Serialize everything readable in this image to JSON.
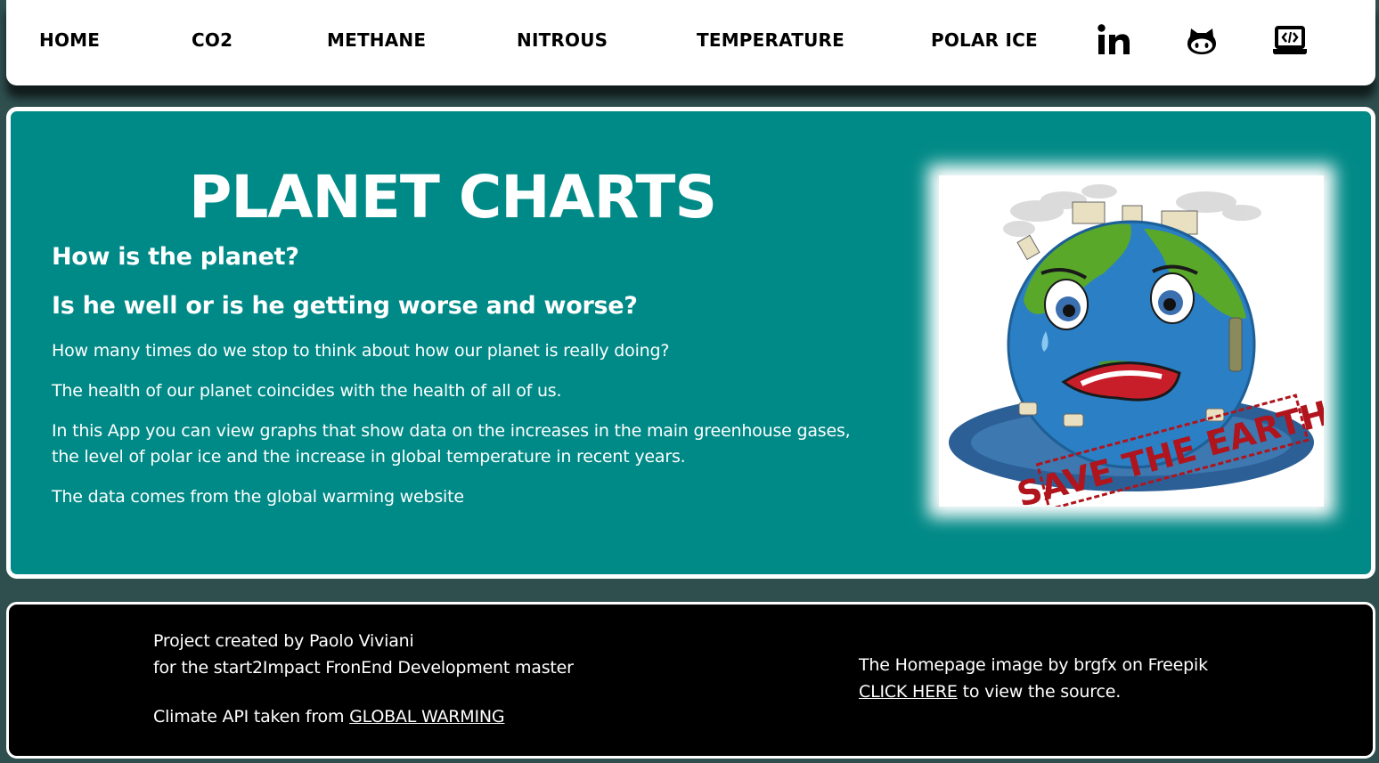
{
  "nav": {
    "items": [
      {
        "label": "HOME"
      },
      {
        "label": "CO2"
      },
      {
        "label": "METHANE"
      },
      {
        "label": "NITROUS"
      },
      {
        "label": "TEMPERATURE"
      },
      {
        "label": "POLAR ICE"
      }
    ],
    "icons": [
      "linkedin-icon",
      "github-icon",
      "laptop-code-icon"
    ]
  },
  "hero": {
    "title": "PLANET CHARTS",
    "subtitle1": "How is the planet?",
    "subtitle2": "Is he well or is he getting worse and worse?",
    "paragraphs": [
      "How many times do we stop to think about how our planet is really doing?",
      "The health of our planet coincides with the health of all of us.",
      "In this App you can view graphs that show data on the increases in the main greenhouse gases, the level of polar ice and the increase in global temperature in recent years.",
      "The data comes from the global warming website"
    ],
    "image_stamp_text": "SAVE THE EARTH"
  },
  "footer": {
    "credit_line1": "Project created by Paolo Viviani",
    "credit_line2": "for the start2Impact FronEnd Development master",
    "api_prefix": "Climate API taken from ",
    "api_link": "GLOBAL WARMING",
    "image_credit": "The Homepage image by brgfx on Freepik",
    "source_link": "CLICK HERE",
    "source_suffix": " to view the source."
  },
  "colors": {
    "background": "#2f4f4f",
    "hero": "#008a87",
    "footer": "#000000",
    "navbar": "#ffffff"
  }
}
